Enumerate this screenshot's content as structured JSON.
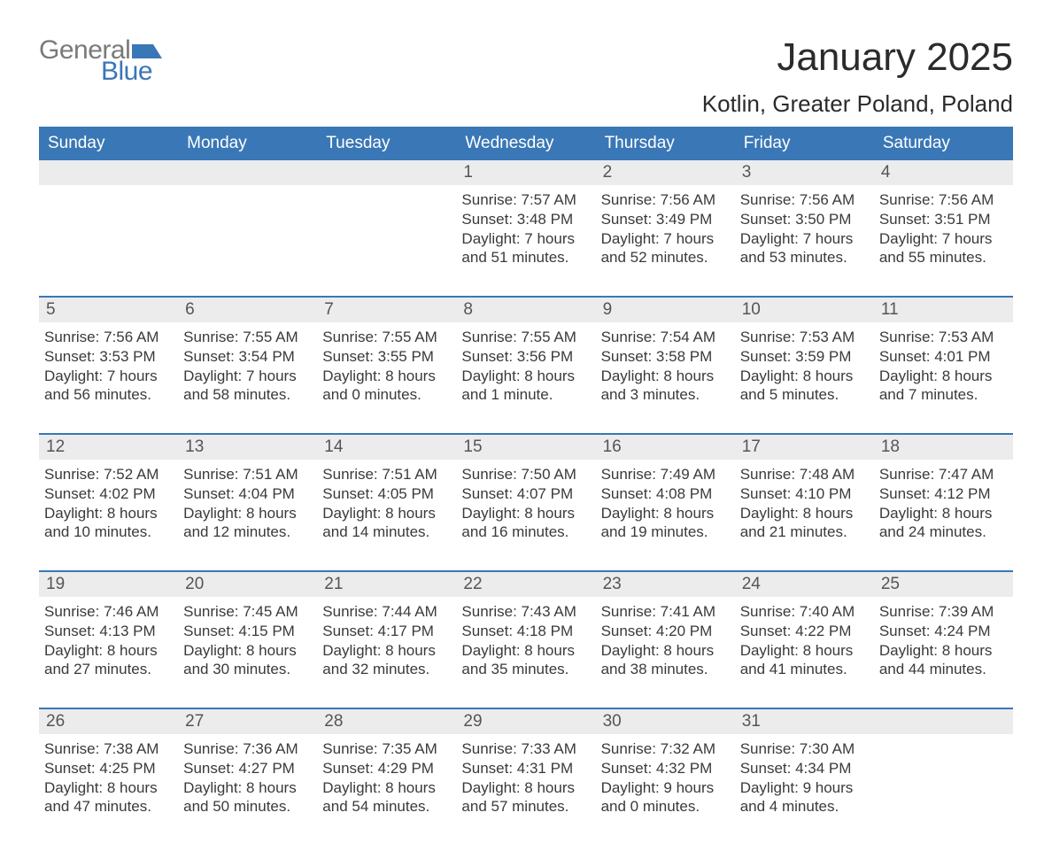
{
  "brand": {
    "word1": "General",
    "word2": "Blue"
  },
  "title": "January 2025",
  "location": "Kotlin, Greater Poland, Poland",
  "dow": [
    "Sunday",
    "Monday",
    "Tuesday",
    "Wednesday",
    "Thursday",
    "Friday",
    "Saturday"
  ],
  "weeks": [
    [
      {
        "n": "",
        "sunrise": "",
        "sunset": "",
        "daylight": ""
      },
      {
        "n": "",
        "sunrise": "",
        "sunset": "",
        "daylight": ""
      },
      {
        "n": "",
        "sunrise": "",
        "sunset": "",
        "daylight": ""
      },
      {
        "n": "1",
        "sunrise": "Sunrise: 7:57 AM",
        "sunset": "Sunset: 3:48 PM",
        "daylight": "Daylight: 7 hours and 51 minutes."
      },
      {
        "n": "2",
        "sunrise": "Sunrise: 7:56 AM",
        "sunset": "Sunset: 3:49 PM",
        "daylight": "Daylight: 7 hours and 52 minutes."
      },
      {
        "n": "3",
        "sunrise": "Sunrise: 7:56 AM",
        "sunset": "Sunset: 3:50 PM",
        "daylight": "Daylight: 7 hours and 53 minutes."
      },
      {
        "n": "4",
        "sunrise": "Sunrise: 7:56 AM",
        "sunset": "Sunset: 3:51 PM",
        "daylight": "Daylight: 7 hours and 55 minutes."
      }
    ],
    [
      {
        "n": "5",
        "sunrise": "Sunrise: 7:56 AM",
        "sunset": "Sunset: 3:53 PM",
        "daylight": "Daylight: 7 hours and 56 minutes."
      },
      {
        "n": "6",
        "sunrise": "Sunrise: 7:55 AM",
        "sunset": "Sunset: 3:54 PM",
        "daylight": "Daylight: 7 hours and 58 minutes."
      },
      {
        "n": "7",
        "sunrise": "Sunrise: 7:55 AM",
        "sunset": "Sunset: 3:55 PM",
        "daylight": "Daylight: 8 hours and 0 minutes."
      },
      {
        "n": "8",
        "sunrise": "Sunrise: 7:55 AM",
        "sunset": "Sunset: 3:56 PM",
        "daylight": "Daylight: 8 hours and 1 minute."
      },
      {
        "n": "9",
        "sunrise": "Sunrise: 7:54 AM",
        "sunset": "Sunset: 3:58 PM",
        "daylight": "Daylight: 8 hours and 3 minutes."
      },
      {
        "n": "10",
        "sunrise": "Sunrise: 7:53 AM",
        "sunset": "Sunset: 3:59 PM",
        "daylight": "Daylight: 8 hours and 5 minutes."
      },
      {
        "n": "11",
        "sunrise": "Sunrise: 7:53 AM",
        "sunset": "Sunset: 4:01 PM",
        "daylight": "Daylight: 8 hours and 7 minutes."
      }
    ],
    [
      {
        "n": "12",
        "sunrise": "Sunrise: 7:52 AM",
        "sunset": "Sunset: 4:02 PM",
        "daylight": "Daylight: 8 hours and 10 minutes."
      },
      {
        "n": "13",
        "sunrise": "Sunrise: 7:51 AM",
        "sunset": "Sunset: 4:04 PM",
        "daylight": "Daylight: 8 hours and 12 minutes."
      },
      {
        "n": "14",
        "sunrise": "Sunrise: 7:51 AM",
        "sunset": "Sunset: 4:05 PM",
        "daylight": "Daylight: 8 hours and 14 minutes."
      },
      {
        "n": "15",
        "sunrise": "Sunrise: 7:50 AM",
        "sunset": "Sunset: 4:07 PM",
        "daylight": "Daylight: 8 hours and 16 minutes."
      },
      {
        "n": "16",
        "sunrise": "Sunrise: 7:49 AM",
        "sunset": "Sunset: 4:08 PM",
        "daylight": "Daylight: 8 hours and 19 minutes."
      },
      {
        "n": "17",
        "sunrise": "Sunrise: 7:48 AM",
        "sunset": "Sunset: 4:10 PM",
        "daylight": "Daylight: 8 hours and 21 minutes."
      },
      {
        "n": "18",
        "sunrise": "Sunrise: 7:47 AM",
        "sunset": "Sunset: 4:12 PM",
        "daylight": "Daylight: 8 hours and 24 minutes."
      }
    ],
    [
      {
        "n": "19",
        "sunrise": "Sunrise: 7:46 AM",
        "sunset": "Sunset: 4:13 PM",
        "daylight": "Daylight: 8 hours and 27 minutes."
      },
      {
        "n": "20",
        "sunrise": "Sunrise: 7:45 AM",
        "sunset": "Sunset: 4:15 PM",
        "daylight": "Daylight: 8 hours and 30 minutes."
      },
      {
        "n": "21",
        "sunrise": "Sunrise: 7:44 AM",
        "sunset": "Sunset: 4:17 PM",
        "daylight": "Daylight: 8 hours and 32 minutes."
      },
      {
        "n": "22",
        "sunrise": "Sunrise: 7:43 AM",
        "sunset": "Sunset: 4:18 PM",
        "daylight": "Daylight: 8 hours and 35 minutes."
      },
      {
        "n": "23",
        "sunrise": "Sunrise: 7:41 AM",
        "sunset": "Sunset: 4:20 PM",
        "daylight": "Daylight: 8 hours and 38 minutes."
      },
      {
        "n": "24",
        "sunrise": "Sunrise: 7:40 AM",
        "sunset": "Sunset: 4:22 PM",
        "daylight": "Daylight: 8 hours and 41 minutes."
      },
      {
        "n": "25",
        "sunrise": "Sunrise: 7:39 AM",
        "sunset": "Sunset: 4:24 PM",
        "daylight": "Daylight: 8 hours and 44 minutes."
      }
    ],
    [
      {
        "n": "26",
        "sunrise": "Sunrise: 7:38 AM",
        "sunset": "Sunset: 4:25 PM",
        "daylight": "Daylight: 8 hours and 47 minutes."
      },
      {
        "n": "27",
        "sunrise": "Sunrise: 7:36 AM",
        "sunset": "Sunset: 4:27 PM",
        "daylight": "Daylight: 8 hours and 50 minutes."
      },
      {
        "n": "28",
        "sunrise": "Sunrise: 7:35 AM",
        "sunset": "Sunset: 4:29 PM",
        "daylight": "Daylight: 8 hours and 54 minutes."
      },
      {
        "n": "29",
        "sunrise": "Sunrise: 7:33 AM",
        "sunset": "Sunset: 4:31 PM",
        "daylight": "Daylight: 8 hours and 57 minutes."
      },
      {
        "n": "30",
        "sunrise": "Sunrise: 7:32 AM",
        "sunset": "Sunset: 4:32 PM",
        "daylight": "Daylight: 9 hours and 0 minutes."
      },
      {
        "n": "31",
        "sunrise": "Sunrise: 7:30 AM",
        "sunset": "Sunset: 4:34 PM",
        "daylight": "Daylight: 9 hours and 4 minutes."
      },
      {
        "n": "",
        "sunrise": "",
        "sunset": "",
        "daylight": ""
      }
    ]
  ]
}
